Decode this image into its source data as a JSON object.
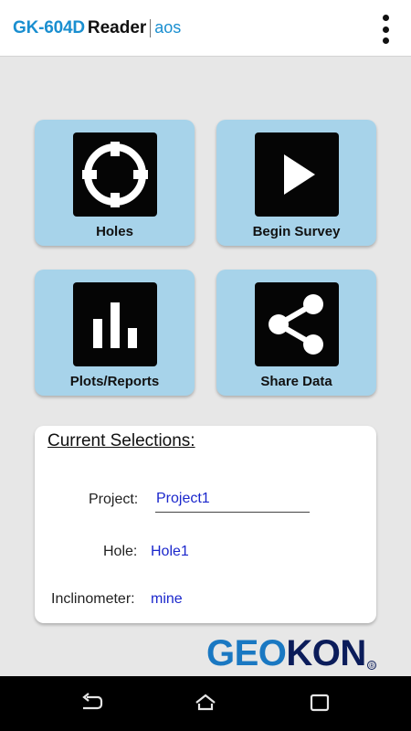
{
  "app_bar": {
    "title_model": "GK-604D",
    "title_reader": "Reader",
    "title_suffix": "aos",
    "menu_icon": "overflow-menu-icon"
  },
  "tiles": [
    {
      "label": "Holes",
      "icon": "crosshair-target-icon"
    },
    {
      "label": "Begin Survey",
      "icon": "play-icon"
    },
    {
      "label": "Plots/Reports",
      "icon": "bar-chart-icon"
    },
    {
      "label": "Share Data",
      "icon": "share-icon"
    }
  ],
  "selections": {
    "heading": "Current Selections:",
    "project_label": "Project:",
    "project_value": "Project1",
    "hole_label": "Hole:",
    "hole_value": "Hole1",
    "inclinometer_label": "Inclinometer:",
    "inclinometer_value": "mine"
  },
  "logo": {
    "part1": "GEO",
    "part2": "KON",
    "mark": "®"
  },
  "nav_bar": {
    "back_icon": "back-icon",
    "home_icon": "home-icon",
    "recents_icon": "recents-icon"
  },
  "colors": {
    "accent_blue": "#1a8fd0",
    "tile_background": "#a7d3ea",
    "value_text": "#1b27cc",
    "logo_dark": "#0b1c5a",
    "page_background": "#e7e7e7"
  }
}
